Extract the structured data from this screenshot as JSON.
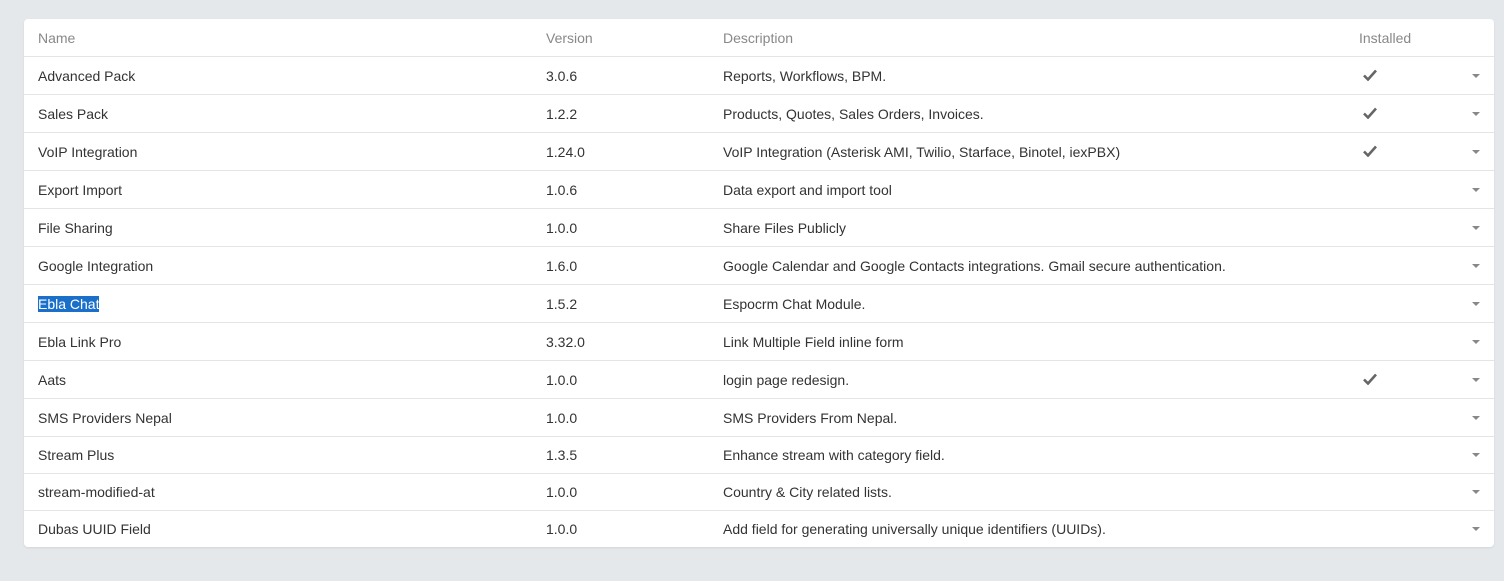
{
  "columns": {
    "name": "Name",
    "version": "Version",
    "description": "Description",
    "installed": "Installed"
  },
  "rows": [
    {
      "name": "Advanced Pack",
      "version": "3.0.6",
      "description": "Reports, Workflows, BPM.",
      "installed": true
    },
    {
      "name": "Sales Pack",
      "version": "1.2.2",
      "description": "Products, Quotes, Sales Orders, Invoices.",
      "installed": true
    },
    {
      "name": "VoIP Integration",
      "version": "1.24.0",
      "description": "VoIP Integration (Asterisk AMI, Twilio, Starface, Binotel, iexPBX)",
      "installed": true
    },
    {
      "name": "Export Import",
      "version": "1.0.6",
      "description": "Data export and import tool",
      "installed": false
    },
    {
      "name": "File Sharing",
      "version": "1.0.0",
      "description": "Share Files Publicly",
      "installed": false
    },
    {
      "name": "Google Integration",
      "version": "1.6.0",
      "description": "Google Calendar and Google Contacts integrations. Gmail secure authentication.",
      "installed": false
    },
    {
      "name": "Ebla Chat",
      "version": "1.5.2",
      "description": "Espocrm Chat Module.",
      "installed": false,
      "selected": true
    },
    {
      "name": "Ebla Link Pro",
      "version": "3.32.0",
      "description": "Link Multiple Field inline form",
      "installed": false
    },
    {
      "name": "Aats",
      "version": "1.0.0",
      "description": "login page redesign.",
      "installed": true
    },
    {
      "name": "SMS Providers Nepal",
      "version": "1.0.0",
      "description": "SMS Providers From Nepal.",
      "installed": false
    },
    {
      "name": "Stream Plus",
      "version": "1.3.5",
      "description": "Enhance stream with category field.",
      "installed": false
    },
    {
      "name": "stream-modified-at",
      "version": "1.0.0",
      "description": "Country & City related lists.",
      "installed": false
    },
    {
      "name": "Dubas UUID Field",
      "version": "1.0.0",
      "description": "Add field for generating universally unique identifiers (UUIDs).",
      "installed": false
    }
  ],
  "icons": {
    "installed": "check-icon",
    "row_menu": "caret-down-icon"
  },
  "colors": {
    "background": "#e5e8eb",
    "panel": "#ffffff",
    "header_text": "#888888",
    "selection": "#1a6fc9"
  }
}
